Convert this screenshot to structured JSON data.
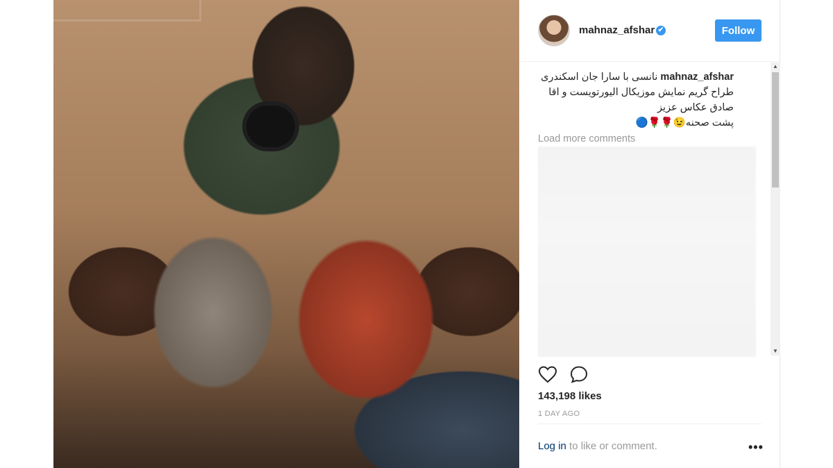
{
  "post": {
    "image_alt": "",
    "username": "mahnaz_afshar",
    "verified_glyph": "✔",
    "follow_label": "Follow",
    "caption": {
      "user": "mahnaz_afshar",
      "line1": "نانسی با سارا جان اسکندری",
      "line2": "طراح گریم نمایش موزیکال الیورتویست و اقا",
      "line3": "صادق عکاس عزیز",
      "line4": "پشت صحنه😉🌹🌹🔵"
    },
    "load_more_label": "Load more comments",
    "likes_text": "143,198 likes",
    "time_text": "1 DAY AGO",
    "login_link": "Log in",
    "login_rest": " to like or comment.",
    "more_glyph": "•••"
  },
  "colors": {
    "accent": "#3897f0",
    "text": "#262626",
    "muted": "#999999",
    "link": "#003569"
  },
  "icons": [
    "heart-icon",
    "comment-icon",
    "more-options-icon",
    "verified-badge-icon"
  ]
}
